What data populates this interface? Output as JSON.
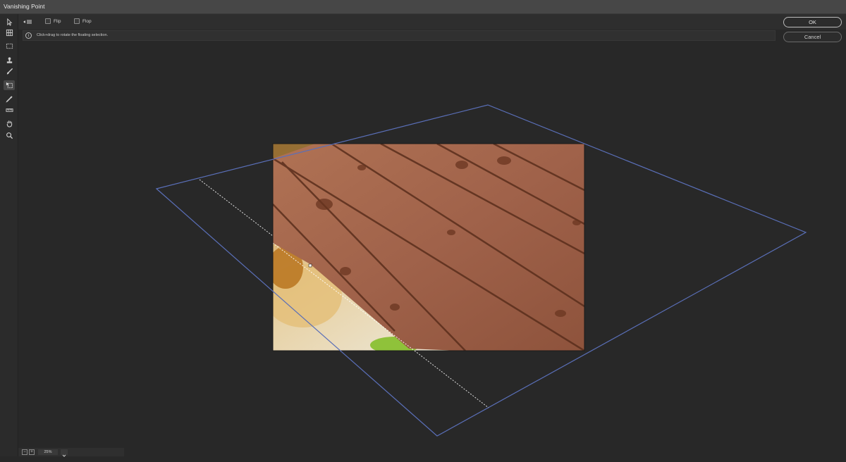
{
  "window": {
    "title": "Vanishing Point"
  },
  "tools": [
    {
      "name": "edit-plane-tool",
      "icon": "arrow-icon"
    },
    {
      "name": "create-plane-tool",
      "icon": "grid-plane-icon"
    },
    {
      "name": "marquee-tool",
      "icon": "marquee-icon"
    },
    {
      "name": "stamp-tool",
      "icon": "stamp-icon"
    },
    {
      "name": "brush-tool",
      "icon": "brush-icon"
    },
    {
      "name": "transform-tool",
      "icon": "transform-icon",
      "active": true
    },
    {
      "name": "eyedropper-tool",
      "icon": "eyedropper-icon"
    },
    {
      "name": "measure-tool",
      "icon": "ruler-icon"
    },
    {
      "name": "hand-tool",
      "icon": "hand-icon"
    },
    {
      "name": "zoom-tool",
      "icon": "magnifier-icon"
    }
  ],
  "options": {
    "flip_label": "Flip",
    "flop_label": "Flop"
  },
  "info": {
    "text": "Click+drag to rotate the floating selection."
  },
  "buttons": {
    "ok": "OK",
    "cancel": "Cancel"
  },
  "status": {
    "zoom": "25%",
    "zoom_out": "−",
    "zoom_in": "+"
  },
  "colors": {
    "plane_grid": "#5a6fb8",
    "wood": "#9a5a3f",
    "background": "#282828"
  }
}
